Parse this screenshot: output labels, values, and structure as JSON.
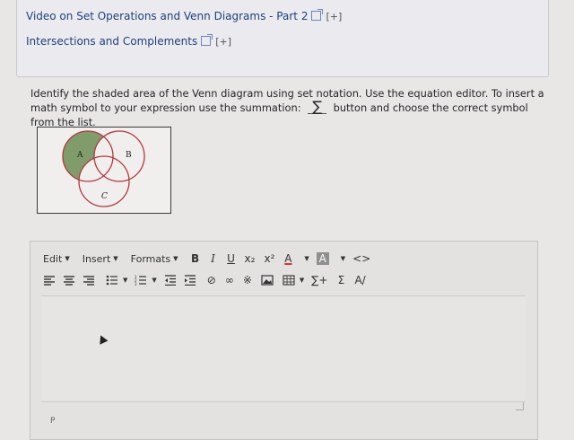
{
  "resources": {
    "link1": "Video on Set Operations and Venn Diagrams - Part 2",
    "link1_expand": "[+]",
    "link2": "Intersections and Complements",
    "link2_expand": "[+]"
  },
  "question": {
    "text_before": "Identify the shaded area of the Venn diagram using set notation. Use the equation editor. To insert a math symbol to your expression use the summation:",
    "sigma": "∑",
    "text_after": "button and choose the correct symbol from the list."
  },
  "venn": {
    "label_a": "A",
    "label_b": "B",
    "label_c": "C",
    "shaded_region": "A only",
    "shade_color": "#7f9c6a",
    "circle_color": "#b2383e"
  },
  "toolbar": {
    "edit": "Edit",
    "insert": "Insert",
    "formats": "Formats",
    "bold": "B",
    "italic": "I",
    "underline": "U",
    "subscript": "x₂",
    "superscript": "x²",
    "font_color": "A",
    "bg_color": "A",
    "code": "<>",
    "summation_plus": "∑+",
    "summation": "Σ",
    "clear_format": "A/"
  },
  "editor": {
    "status_path": "P"
  }
}
